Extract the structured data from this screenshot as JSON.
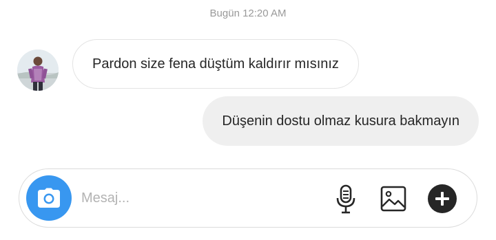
{
  "thread": {
    "timestamp": "Bugün 12:20 AM",
    "messages": [
      {
        "direction": "incoming",
        "text": "Pardon size fena düştüm kaldırır mısınız"
      },
      {
        "direction": "outgoing",
        "text": "Düşenin dostu olmaz kusura bakmayın"
      }
    ]
  },
  "composer": {
    "placeholder": "Mesaj...",
    "value": "",
    "icons": {
      "camera": "camera-icon",
      "mic": "microphone-icon",
      "gallery": "gallery-icon",
      "plus": "plus-icon"
    }
  },
  "colors": {
    "accent": "#3897f0",
    "outgoing_bubble": "#efefef",
    "incoming_border": "#e3e3e3",
    "text": "#262626",
    "timestamp": "#999999"
  }
}
